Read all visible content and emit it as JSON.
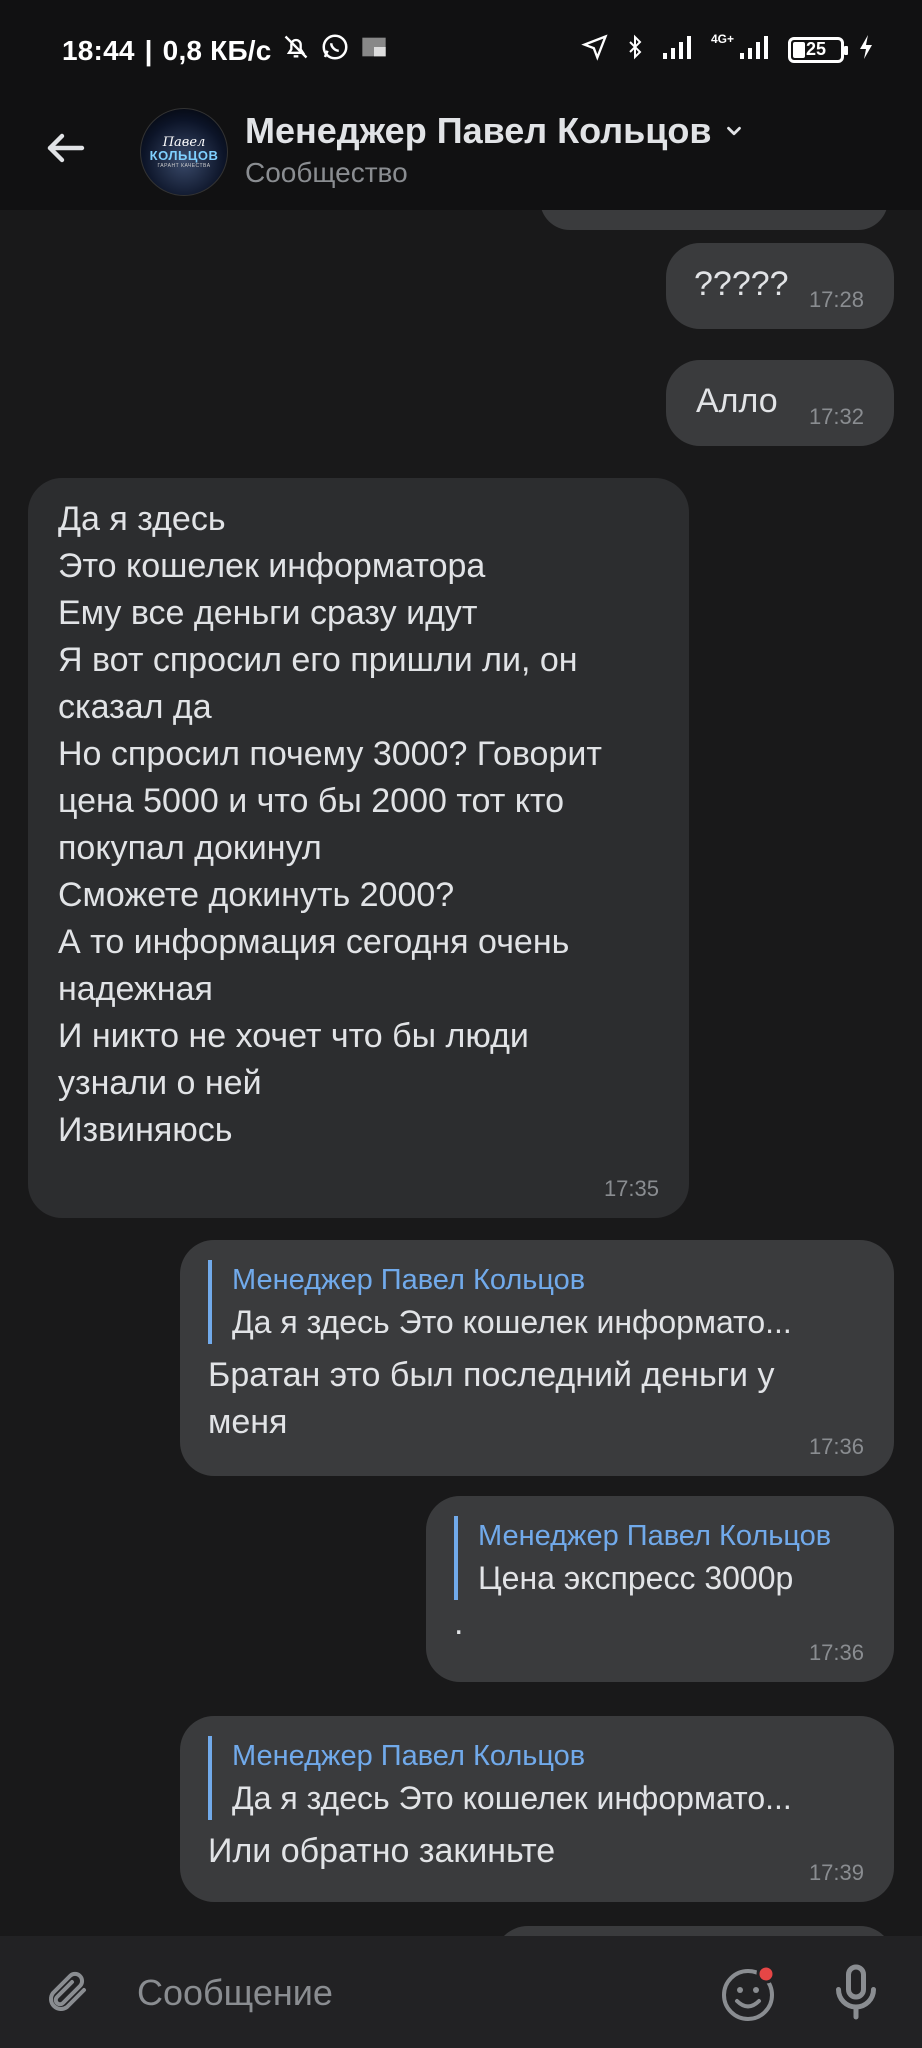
{
  "status_bar": {
    "time": "18:44",
    "separator": "|",
    "speed": "0,8 КБ/с",
    "network": "4G+",
    "battery": "25"
  },
  "header": {
    "title": "Менеджер Павел Кольцов",
    "subtitle": "Сообщество",
    "avatar": {
      "line1": "Павел",
      "line2": "КОЛЬЦОВ",
      "line3": "ГАРАНТ КАЧЕСТВА"
    }
  },
  "messages": [
    {
      "direction": "out",
      "text": "?????",
      "time": "17:28"
    },
    {
      "direction": "out",
      "text": "Алло",
      "time": "17:32"
    },
    {
      "direction": "in",
      "text": "Да я здесь\nЭто кошелек информатора\nЕму все деньги сразу идут\nЯ вот спросил его пришли ли, он\nсказал да\nНо спросил почему 3000? Говорит\nцена 5000 и что бы 2000 тот кто\nпокупал докинул\nСможете докинуть 2000?\nА то информация сегодня очень\nнадежная\nИ никто не хочет что бы люди\nузнали о ней\nИзвиняюсь",
      "time": "17:35"
    },
    {
      "direction": "out",
      "reply_author": "Менеджер Павел Кольцов",
      "reply_text": "Да я здесь  Это кошелек информато...",
      "text": "Братан это был последний деньги у\nменя",
      "time": "17:36"
    },
    {
      "direction": "out",
      "reply_author": "Менеджер Павел Кольцов",
      "reply_text": "Цена экспресс 3000р",
      "text": ".",
      "time": "17:36"
    },
    {
      "direction": "out",
      "reply_author": "Менеджер Павел Кольцов",
      "reply_text": "Да я здесь  Это кошелек информато...",
      "text": "Или обратно закиньте",
      "time": "17:39"
    }
  ],
  "composer": {
    "placeholder": "Сообщение"
  },
  "icons": {
    "back": "arrow-left-icon",
    "attach": "paperclip-icon",
    "emoji": "smile-icon",
    "mic": "microphone-icon"
  },
  "colors": {
    "background": "#19191a",
    "bubble_in": "#2c2d2f",
    "bubble_out": "#3a3b3d",
    "accent": "#71aaeb",
    "notification_dot": "#e64646"
  }
}
